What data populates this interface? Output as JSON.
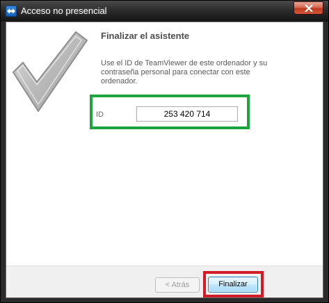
{
  "window": {
    "title": "Acceso no presencial",
    "app_icon": "teamviewer-icon",
    "close_icon": "close-icon"
  },
  "wizard": {
    "illustration": "checkmark-icon",
    "heading": "Finalizar el asistente",
    "description": "Use el ID de TeamViewer de este ordenador y su contraseña personal para conectar con este ordenador.",
    "id_label": "ID",
    "id_value": "253 420 714"
  },
  "buttons": {
    "back_label": "< Atrás",
    "finish_label": "Finalizar"
  },
  "colors": {
    "highlight_green": "#1ea43f",
    "highlight_red": "#d01d27",
    "titlebar": "#2c2c2c",
    "close_button": "#c0391f"
  }
}
